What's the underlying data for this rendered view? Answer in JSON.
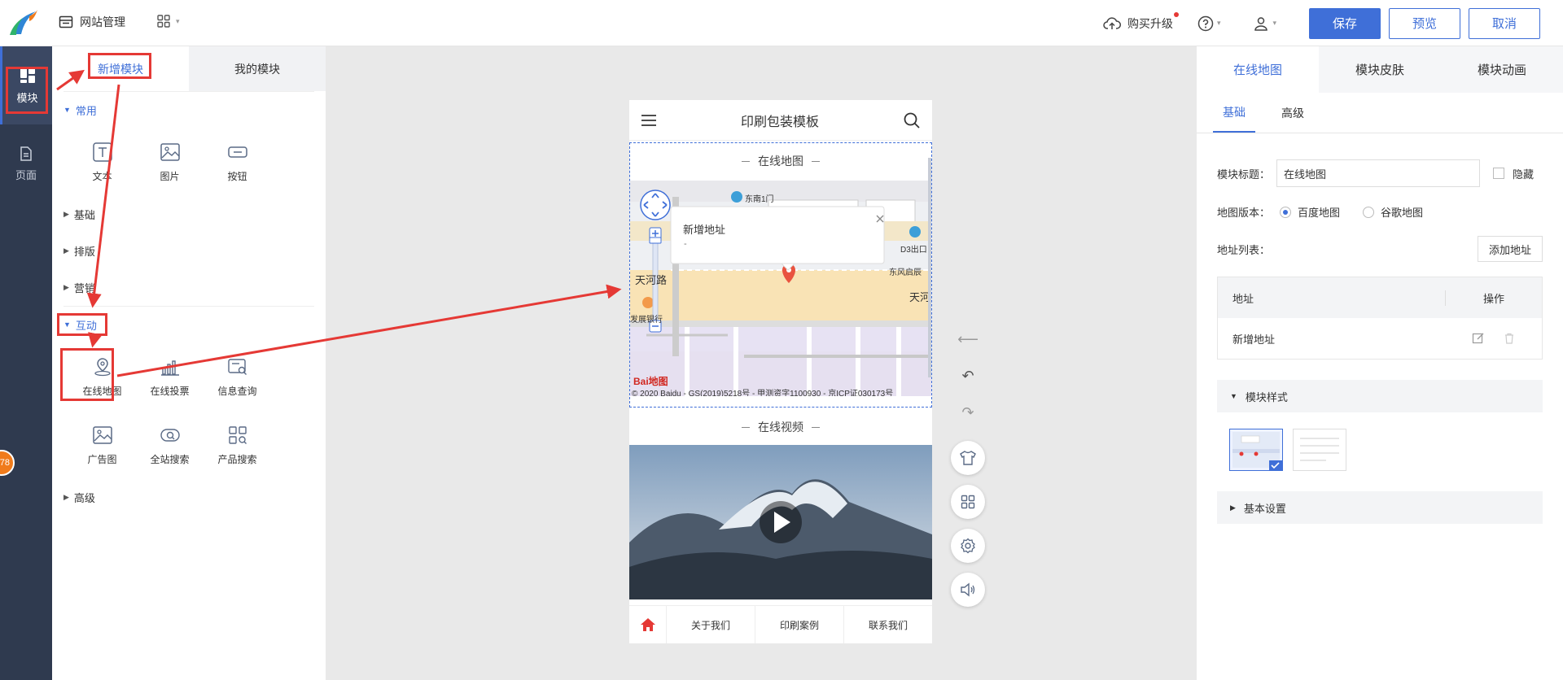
{
  "topbar": {
    "site_mgmt_label": "网站管理",
    "buy_upgrade_label": "购买升级",
    "save_label": "保存",
    "preview_label": "预览",
    "cancel_label": "取消"
  },
  "rail": {
    "module_label": "模块",
    "page_label": "页面",
    "badge": "78"
  },
  "module_panel": {
    "tabs": [
      {
        "label": "新增模块"
      },
      {
        "label": "我的模块"
      }
    ],
    "sections": {
      "common": "常用",
      "basic": "基础",
      "layout": "排版",
      "marketing": "营销",
      "interactive": "互动",
      "advanced": "高级"
    },
    "common_items": [
      {
        "label": "文本"
      },
      {
        "label": "图片"
      },
      {
        "label": "按钮"
      }
    ],
    "interactive_items": [
      {
        "label": "在线地图"
      },
      {
        "label": "在线投票"
      },
      {
        "label": "信息查询"
      },
      {
        "label": "广告图"
      },
      {
        "label": "全站搜索"
      },
      {
        "label": "产品搜索"
      }
    ]
  },
  "phone": {
    "title": "印刷包装模板",
    "map_section_title": "在线地图",
    "video_section_title": "在线视频",
    "map": {
      "popup_title": "新增地址",
      "popup_sub": "-",
      "labels": [
        "东南1门",
        "D3出口",
        "天河路",
        "东风启辰",
        "天河",
        "发展银行"
      ],
      "copyright": "© 2020 Baidu - GS(2019)5218号 - 甲测资字1100930 - 京ICP证030173号",
      "logo_text": "Bai地图"
    },
    "nav": [
      "关于我们",
      "印刷案例",
      "联系我们"
    ]
  },
  "right_panel": {
    "tabs": [
      {
        "label": "在线地图"
      },
      {
        "label": "模块皮肤"
      },
      {
        "label": "模块动画"
      }
    ],
    "subtabs": [
      {
        "label": "基础"
      },
      {
        "label": "高级"
      }
    ],
    "module_title_label": "模块标题：",
    "module_title_value": "在线地图",
    "hide_label": "隐藏",
    "map_version_label": "地图版本：",
    "map_versions": [
      "百度地图",
      "谷歌地图"
    ],
    "address_list_label": "地址列表：",
    "add_address_label": "添加地址",
    "table_headers": [
      "地址",
      "操作"
    ],
    "table_rows": [
      {
        "address": "新增地址"
      }
    ],
    "module_style_label": "模块样式",
    "basic_settings_label": "基本设置"
  },
  "colors": {
    "accent": "#3f6fd8",
    "rail_bg": "#2f3a4f",
    "annotation_red": "#e53935",
    "badge_orange": "#f07b1b"
  }
}
